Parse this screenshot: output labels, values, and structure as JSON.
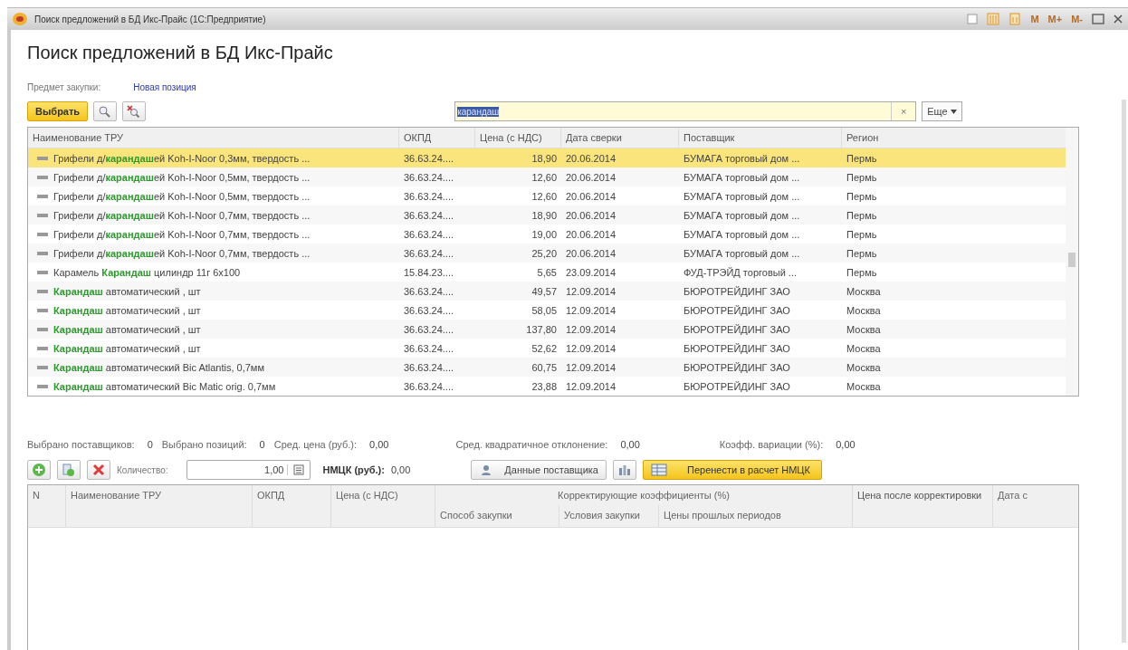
{
  "window": {
    "title": "Поиск предложений в БД Икс-Прайс  (1С:Предприятие)",
    "tools": [
      "M",
      "M+",
      "M-"
    ]
  },
  "title": "Поиск предложений в БД Икс-Прайс",
  "subject": {
    "label": "Предмет закупки:",
    "value": "Новая позиция"
  },
  "toolbar": {
    "select_button": "Выбрать",
    "search": {
      "value": "карандаш",
      "clear": "×"
    },
    "more_button": "Еще"
  },
  "offers": {
    "columns": [
      "Наименование ТРУ",
      "ОКПД",
      "Цена (с НДС)",
      "Дата сверки",
      "Поставщик",
      "Регион"
    ],
    "rows": [
      {
        "selected": true,
        "name": "Грифели д/**карандаш**ей Koh-I-Noor 0,3мм, твердость ...",
        "okpd": "36.63.24....",
        "price": "18,90",
        "date": "20.06.2014",
        "supplier": "БУМАГА торговый дом ...",
        "region": "Пермь"
      },
      {
        "selected": false,
        "name": "Грифели д/**карандаш**ей Koh-I-Noor 0,5мм, твердость ...",
        "okpd": "36.63.24....",
        "price": "12,60",
        "date": "20.06.2014",
        "supplier": "БУМАГА торговый дом ...",
        "region": "Пермь"
      },
      {
        "selected": false,
        "name": "Грифели д/**карандаш**ей Koh-I-Noor 0,5мм, твердость ...",
        "okpd": "36.63.24....",
        "price": "12,60",
        "date": "20.06.2014",
        "supplier": "БУМАГА торговый дом ...",
        "region": "Пермь"
      },
      {
        "selected": false,
        "name": "Грифели д/**карандаш**ей Koh-I-Noor 0,7мм, твердость ...",
        "okpd": "36.63.24....",
        "price": "18,90",
        "date": "20.06.2014",
        "supplier": "БУМАГА торговый дом ...",
        "region": "Пермь"
      },
      {
        "selected": false,
        "name": "Грифели д/**карандаш**ей Koh-I-Noor 0,7мм, твердость ...",
        "okpd": "36.63.24....",
        "price": "19,00",
        "date": "20.06.2014",
        "supplier": "БУМАГА торговый дом ...",
        "region": "Пермь"
      },
      {
        "selected": false,
        "name": "Грифели д/**карандаш**ей Koh-I-Noor 0,7мм, твердость ...",
        "okpd": "36.63.24....",
        "price": "25,20",
        "date": "20.06.2014",
        "supplier": "БУМАГА торговый дом ...",
        "region": "Пермь"
      },
      {
        "selected": false,
        "name": "Карамель **Карандаш** цилиндр 11г 6х100",
        "okpd": "15.84.23....",
        "price": "5,65",
        "date": "23.09.2014",
        "supplier": "ФУД-ТРЭЙД торговый ...",
        "region": "Пермь"
      },
      {
        "selected": false,
        "name": "**Карандаш** автоматический , шт",
        "okpd": "36.63.24....",
        "price": "49,57",
        "date": "12.09.2014",
        "supplier": "БЮРОТРЕЙДИНГ ЗАО",
        "region": "Москва"
      },
      {
        "selected": false,
        "name": "**Карандаш** автоматический , шт",
        "okpd": "36.63.24....",
        "price": "58,05",
        "date": "12.09.2014",
        "supplier": "БЮРОТРЕЙДИНГ ЗАО",
        "region": "Москва"
      },
      {
        "selected": false,
        "name": "**Карандаш** автоматический , шт",
        "okpd": "36.63.24....",
        "price": "137,80",
        "date": "12.09.2014",
        "supplier": "БЮРОТРЕЙДИНГ ЗАО",
        "region": "Москва"
      },
      {
        "selected": false,
        "name": "**Карандаш** автоматический , шт",
        "okpd": "36.63.24....",
        "price": "52,62",
        "date": "12.09.2014",
        "supplier": "БЮРОТРЕЙДИНГ ЗАО",
        "region": "Москва"
      },
      {
        "selected": false,
        "name": "**Карандаш** автоматический Bic Atlantis, 0,7мм",
        "okpd": "36.63.24....",
        "price": "60,75",
        "date": "12.09.2014",
        "supplier": "БЮРОТРЕЙДИНГ ЗАО",
        "region": "Москва"
      },
      {
        "selected": false,
        "name": "**Карандаш** автоматический Bic Matic orig. 0,7мм",
        "okpd": "36.63.24....",
        "price": "23,88",
        "date": "12.09.2014",
        "supplier": "БЮРОТРЕЙДИНГ ЗАО",
        "region": "Москва"
      }
    ]
  },
  "stats": [
    {
      "label": "Выбрано поставщиков:",
      "value": "0"
    },
    {
      "label": "Выбрано позиций:",
      "value": "0"
    },
    {
      "label": "Сред. цена (руб.):",
      "value": "0,00"
    },
    {
      "label": "Сред. квадратичное отклонение:",
      "value": "0,00"
    },
    {
      "label": "Коэфф. вариации (%):",
      "value": "0,00"
    }
  ],
  "calc_toolbar": {
    "quantity_label": "Количество:",
    "quantity": "1,00",
    "nmck_label": "НМЦК (руб.):",
    "nmck": "0,00",
    "supplier_button": "Данные поставщика",
    "transfer_button": "Перенести в расчет НМЦК"
  },
  "calc_table": {
    "columns": [
      "N",
      "Наименование ТРУ",
      "ОКПД",
      "Цена (с НДС)"
    ],
    "group": {
      "label": "Корректирующие коэффициенты (%)",
      "columns": [
        "Способ закупки",
        "Условия закупки",
        "Цены прошлых периодов"
      ]
    },
    "tail_columns": [
      "Цена после корректировки",
      "Дата с"
    ]
  }
}
